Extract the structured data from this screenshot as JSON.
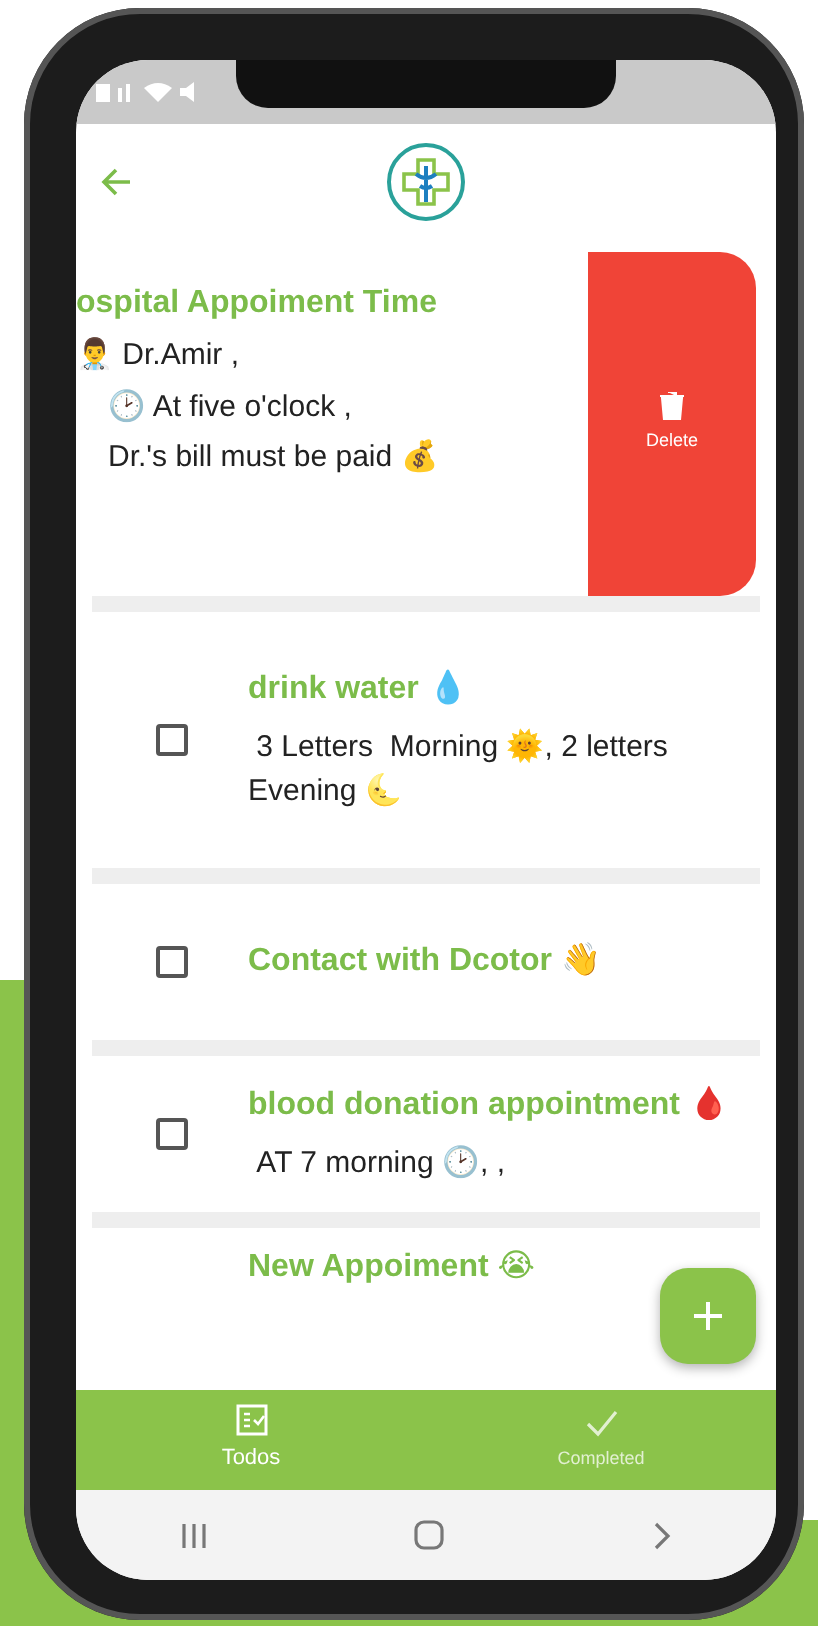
{
  "todos": [
    {
      "kind": "swiped",
      "title": "ospital Appoiment Time",
      "lines": [
        "👨‍⚕️ Dr.Amir ,",
        "🕑 At five o'clock ,",
        "Dr.'s bill must be paid 💰"
      ],
      "action": "Delete"
    },
    {
      "kind": "check",
      "checked": false,
      "title": "drink water 💧",
      "lines": [
        " 3 Letters  Morning 🌞, 2 letters Evening 🌜"
      ]
    },
    {
      "kind": "check",
      "checked": false,
      "title": "Contact with Dcotor 👋"
    },
    {
      "kind": "check",
      "checked": false,
      "title": "blood donation appointment 🩸",
      "lines": [
        " AT 7 morning 🕑, ,"
      ]
    },
    {
      "kind": "partial",
      "title": "New Appoiment 😭"
    }
  ],
  "tabs": [
    {
      "label": "Todos",
      "selected": true
    },
    {
      "label": "Completed",
      "selected": false
    }
  ]
}
